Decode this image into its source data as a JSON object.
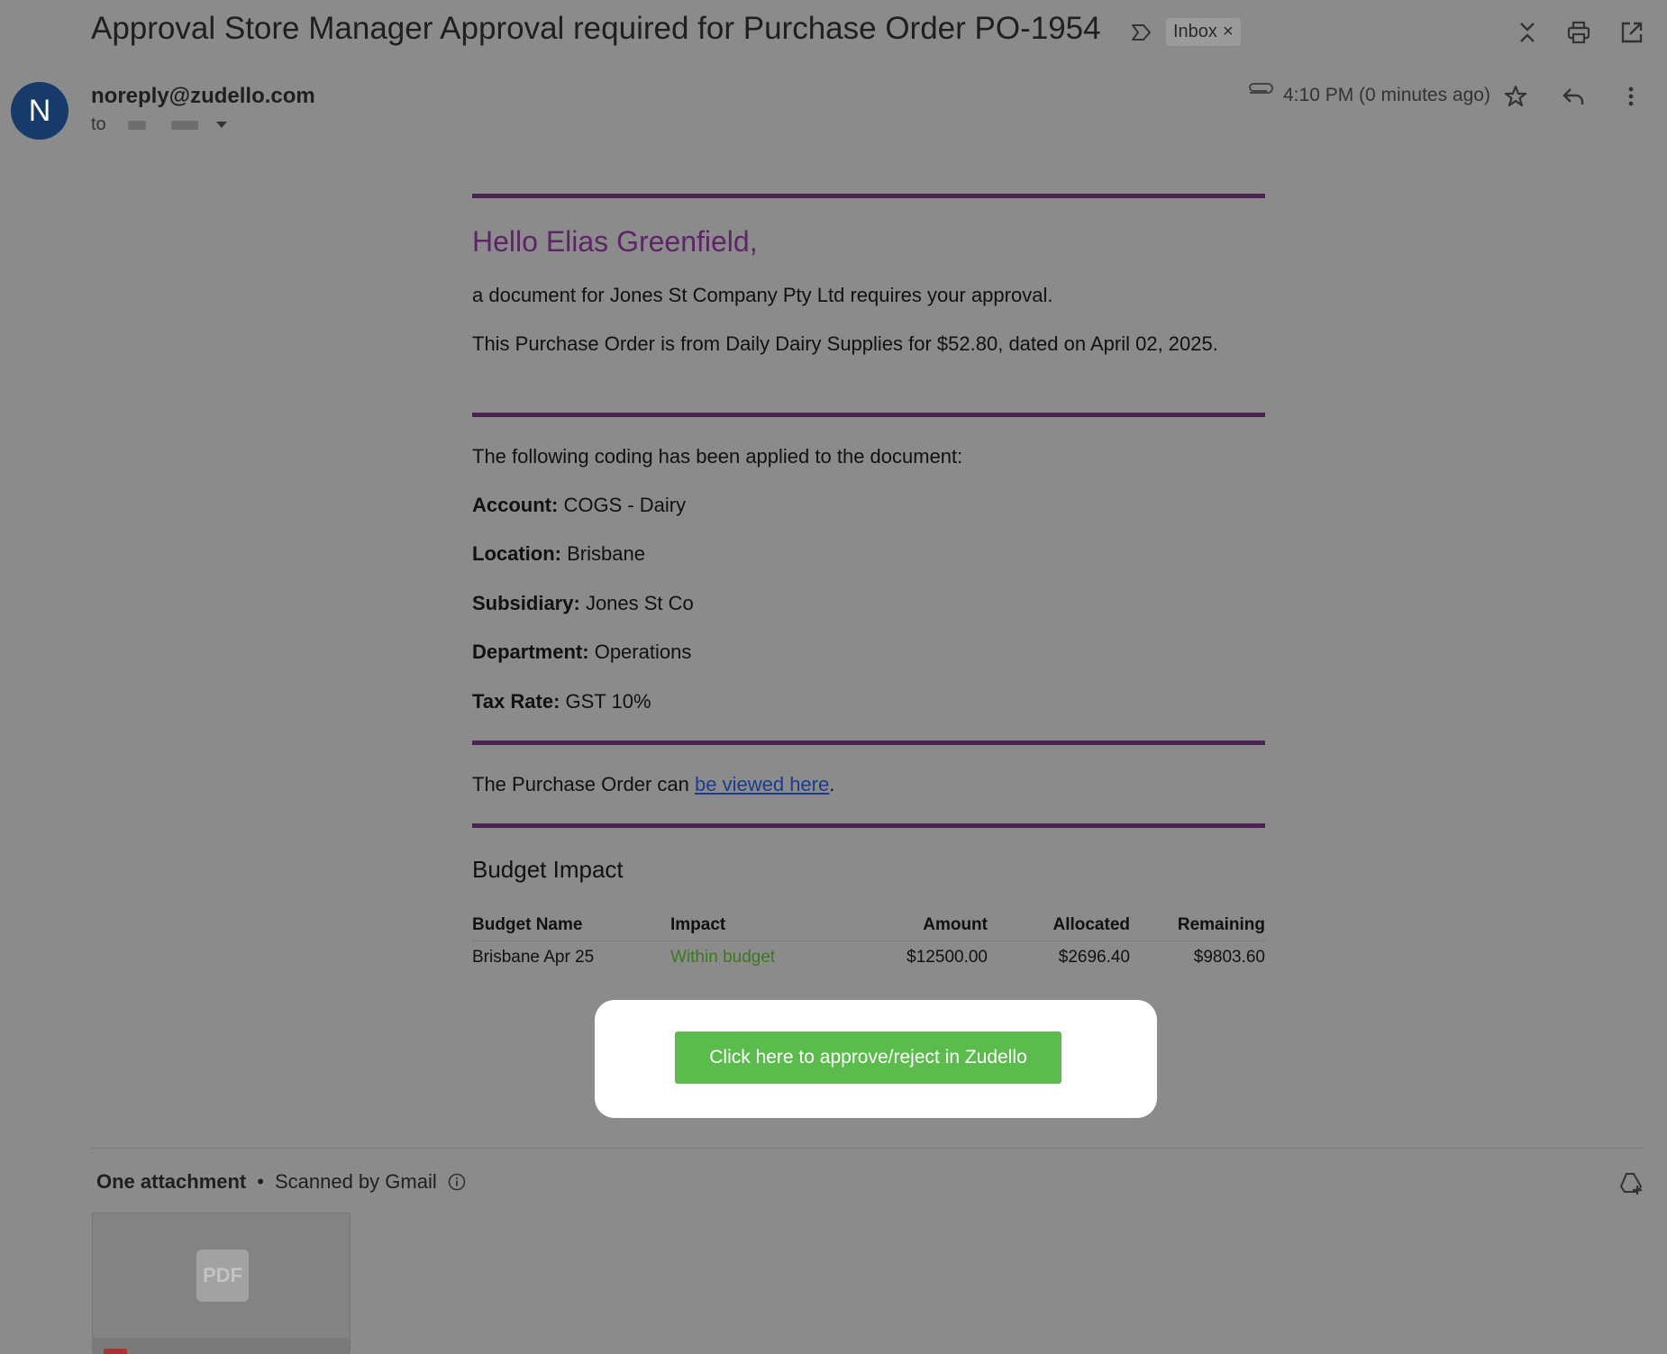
{
  "header": {
    "subject": "Approval Store Manager Approval required for Purchase Order PO-1954",
    "inbox_label": "Inbox",
    "inbox_remove": "×"
  },
  "sender": {
    "avatar_letter": "N",
    "email": "noreply@zudello.com",
    "to_label": "to",
    "timestamp": "4:10 PM (0 minutes ago)"
  },
  "body": {
    "greeting": "Hello Elias Greenfield,",
    "line1": "a document for Jones St Company Pty Ltd requires your approval.",
    "line2": "This Purchase Order is from Daily Dairy Supplies for $52.80, dated on April 02, 2025.",
    "coding_intro": "The following coding has been applied to the document:",
    "coding": [
      {
        "label": "Account:",
        "value": "COGS - Dairy"
      },
      {
        "label": "Location:",
        "value": "Brisbane"
      },
      {
        "label": "Subsidiary:",
        "value": "Jones St Co"
      },
      {
        "label": "Department:",
        "value": "Operations"
      },
      {
        "label": "Tax Rate:",
        "value": "GST 10%"
      }
    ],
    "view_prefix": "The Purchase Order can ",
    "view_link": "be viewed here",
    "view_suffix": ".",
    "budget_heading": "Budget Impact",
    "budget_table": {
      "headers": [
        "Budget Name",
        "Impact",
        "Amount",
        "Allocated",
        "Remaining"
      ],
      "rows": [
        [
          "Brisbane Apr 25",
          "Within budget",
          "$12500.00",
          "$2696.40",
          "$9803.60"
        ]
      ]
    },
    "cta_label": "Click here to approve/reject in Zudello"
  },
  "attachments": {
    "count_label": "One attachment",
    "separator": "•",
    "scan_label": "Scanned by Gmail",
    "file_type": "PDF"
  },
  "colors": {
    "accent_purple": "#4b2352",
    "greeting_purple": "#5e2468",
    "cta_green": "#5bbc4d",
    "impact_green": "#3a7a1f",
    "avatar_blue": "#173a6a"
  },
  "icons": [
    "label-icon",
    "collapse-icon",
    "print-icon",
    "open-in-new-icon",
    "attachment-icon",
    "star-icon",
    "reply-icon",
    "more-vert-icon",
    "info-icon",
    "add-to-drive-icon",
    "pdf-icon"
  ]
}
